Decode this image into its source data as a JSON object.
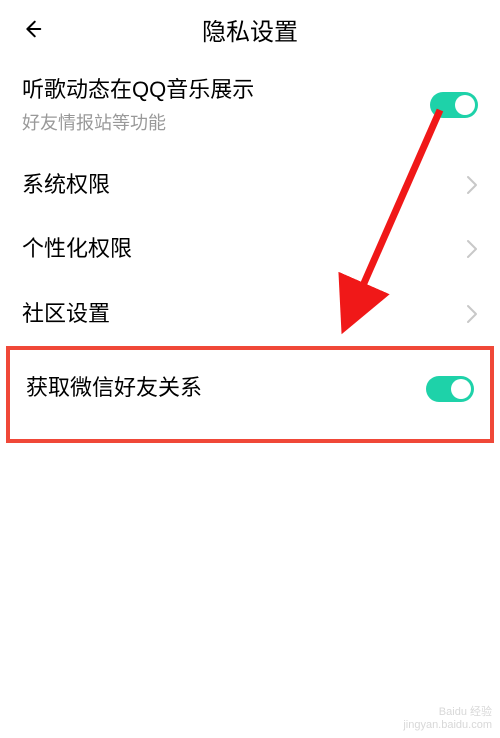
{
  "header": {
    "title": "隐私设置"
  },
  "items": {
    "music": {
      "title": "听歌动态在QQ音乐展示",
      "subtitle": "好友情报站等功能"
    },
    "system": {
      "title": "系统权限"
    },
    "personal": {
      "title": "个性化权限"
    },
    "community": {
      "title": "社区设置"
    },
    "wechat": {
      "title": "获取微信好友关系"
    }
  },
  "colors": {
    "accent": "#1ed2a9",
    "highlight": "#f04838"
  },
  "watermark": {
    "line1": "Baidu 经验",
    "line2": "jingyan.baidu.com"
  }
}
